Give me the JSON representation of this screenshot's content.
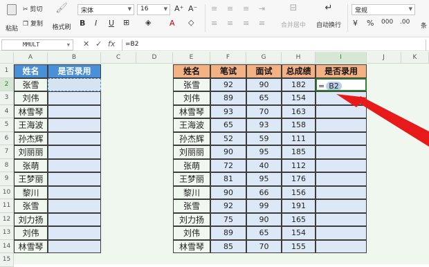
{
  "ribbon": {
    "paste_label": "粘贴",
    "cut_label": "剪切",
    "copy_label": "复制",
    "format_painter_label": "格式刷",
    "font_name": "宋体",
    "font_size": "16",
    "merge_center_label": "合并居中",
    "wrap_text_label": "自动换行",
    "number_format": "常规",
    "extra_label": "条"
  },
  "formula_bar": {
    "name_box": "MMULT",
    "formula": "=B2"
  },
  "columns": [
    "A",
    "B",
    "C",
    "D",
    "E",
    "F",
    "G",
    "H",
    "I",
    "J",
    "K"
  ],
  "rows": [
    "1",
    "2",
    "3",
    "4",
    "5",
    "6",
    "7",
    "8",
    "9",
    "10",
    "11",
    "12",
    "13",
    "14",
    "15"
  ],
  "left_table": {
    "headers": [
      "姓名",
      "是否录用"
    ],
    "names": [
      "张雪",
      "刘伟",
      "林雪琴",
      "王海波",
      "孙杰辉",
      "刘丽丽",
      "张萌",
      "王梦丽",
      "黎川",
      "张雪",
      "刘力扬",
      "刘伟",
      "林雪琴"
    ]
  },
  "right_table": {
    "headers": [
      "姓名",
      "笔试",
      "面试",
      "总成绩",
      "是否录用"
    ],
    "rows": [
      [
        "张雪",
        "92",
        "90",
        "182"
      ],
      [
        "刘伟",
        "89",
        "65",
        "154"
      ],
      [
        "林雪琴",
        "93",
        "70",
        "163"
      ],
      [
        "王海波",
        "65",
        "93",
        "158"
      ],
      [
        "孙杰辉",
        "52",
        "59",
        "111"
      ],
      [
        "刘丽丽",
        "90",
        "95",
        "185"
      ],
      [
        "张萌",
        "72",
        "40",
        "112"
      ],
      [
        "王梦丽",
        "81",
        "95",
        "176"
      ],
      [
        "黎川",
        "90",
        "66",
        "156"
      ],
      [
        "张雪",
        "92",
        "99",
        "191"
      ],
      [
        "刘力扬",
        "75",
        "90",
        "165"
      ],
      [
        "刘伟",
        "89",
        "65",
        "154"
      ],
      [
        "林雪琴",
        "85",
        "70",
        "155"
      ]
    ],
    "editing_cell": {
      "prefix": "=",
      "ref": "B2"
    }
  },
  "colors": {
    "header_blue": "#4a90d9",
    "header_orange": "#f4b183",
    "light_blue": "#dce8f5",
    "sheet_bg": "#f0f7ef",
    "arrow_red": "#e8191a"
  }
}
